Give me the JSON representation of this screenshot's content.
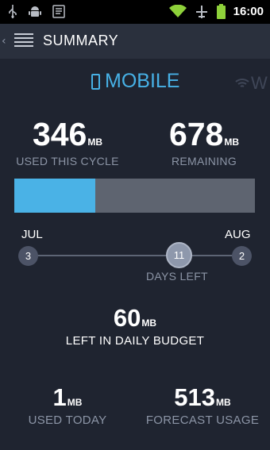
{
  "status_bar": {
    "time": "16:00",
    "icons": [
      "usb-icon",
      "android-icon",
      "notes-icon",
      "wifi-icon",
      "airplane-icon",
      "battery-icon"
    ],
    "battery_color": "#8ed13a"
  },
  "header": {
    "title": "SUMMARY"
  },
  "tabs": [
    {
      "label": "MOBILE",
      "active": true,
      "color": "#47b1e6"
    },
    {
      "label": "W",
      "active": false
    }
  ],
  "usage": {
    "used": {
      "value": "346",
      "unit": "MB",
      "label": "USED THIS CYCLE"
    },
    "remaining": {
      "value": "678",
      "unit": "MB",
      "label": "REMAINING"
    },
    "progress_fraction": 0.338
  },
  "timeline": {
    "start_month": "JUL",
    "end_month": "AUG",
    "start_day": "3",
    "end_day": "2",
    "days_left_value": "11",
    "days_left_label": "DAYS LEFT"
  },
  "daily_budget": {
    "value": "60",
    "unit": "MB",
    "label": "LEFT IN DAILY BUDGET"
  },
  "today": {
    "value": "1",
    "unit": "MB",
    "label": "USED TODAY"
  },
  "forecast": {
    "value": "513",
    "unit": "MB",
    "label": "FORECAST USAGE"
  }
}
